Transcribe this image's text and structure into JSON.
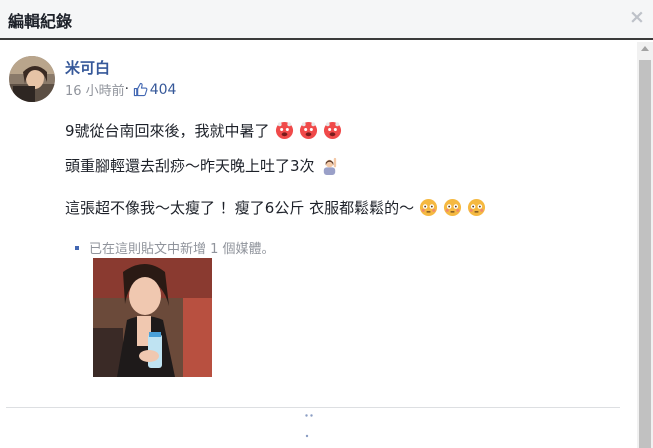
{
  "dialog": {
    "title": "編輯紀錄",
    "close_glyph": "×"
  },
  "post": {
    "author": "米可白",
    "timestamp": "16 小時前",
    "separator": "·",
    "like_count": "404",
    "lines": [
      {
        "text": "9號從台南回來後，我就中暑了",
        "emoji": [
          "hot-face-emoji",
          "hot-face-emoji",
          "hot-face-emoji"
        ]
      },
      {
        "text": "頭重腳輕還去刮痧～昨天晚上吐了3次",
        "emoji": [
          "woman-raising-hand-emoji"
        ]
      },
      {
        "text": "這張超不像我～太瘦了 ！瘦了6公斤 衣服都鬆鬆的～",
        "emoji": [
          "flushed-face-emoji",
          "flushed-face-emoji",
          "flushed-face-emoji"
        ]
      }
    ],
    "media_note": "已在這則貼文中新增 1 個媒體。"
  },
  "colors": {
    "link_blue": "#365899",
    "meta_gray": "#90949c",
    "header_bg": "#f5f6f7",
    "divider": "#dddfe2"
  }
}
